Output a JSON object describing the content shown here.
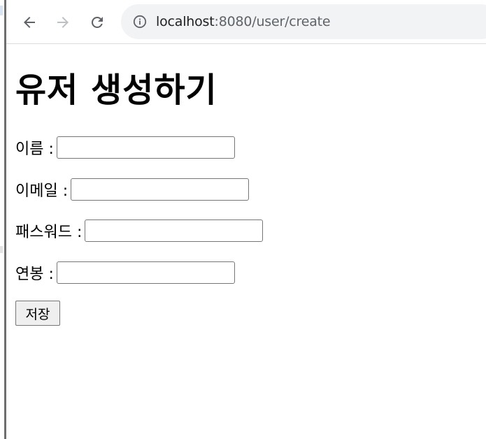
{
  "browser": {
    "url_host": "localhost",
    "url_path": ":8080/user/create",
    "icons": {
      "back": "arrow-left-icon",
      "forward": "arrow-right-icon",
      "reload": "reload-icon",
      "site_info": "info-icon"
    },
    "colors": {
      "toolbar_icon": "#5f6368",
      "toolbar_icon_disabled": "#bdc1c6",
      "address_bar_bg": "#f1f3f4"
    }
  },
  "page": {
    "title": "유저 생성하기",
    "fields": [
      {
        "label": "이름 :",
        "value": "",
        "type": "text"
      },
      {
        "label": "이메일 :",
        "value": "",
        "type": "text"
      },
      {
        "label": "패스워드 :",
        "value": "",
        "type": "password"
      },
      {
        "label": "연봉 :",
        "value": "",
        "type": "text"
      }
    ],
    "save_label": "저장"
  }
}
